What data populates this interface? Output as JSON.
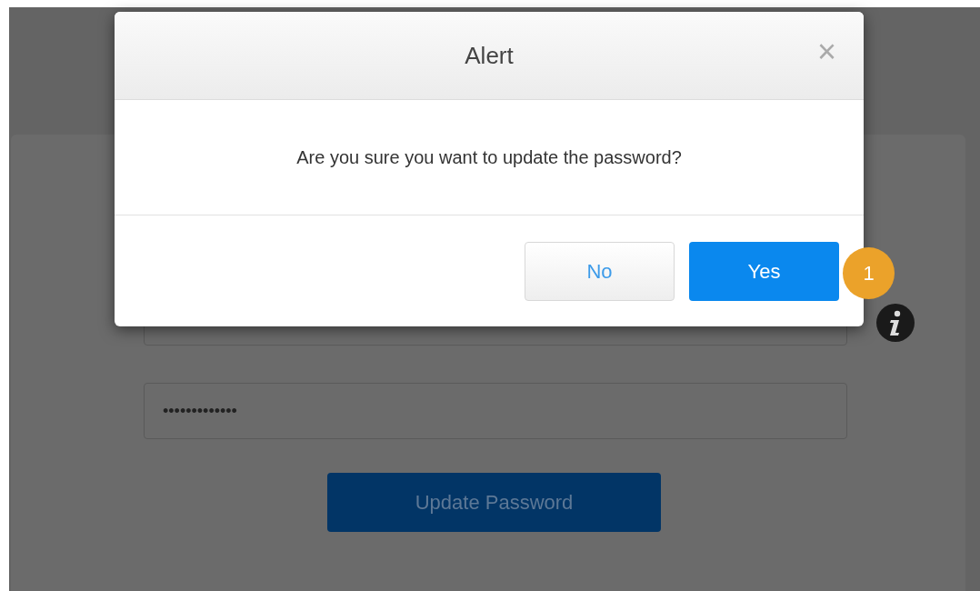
{
  "background": {
    "password_field": {
      "value": "•••••••••••••"
    },
    "update_button": {
      "label": "Update Password",
      "disabled": true
    }
  },
  "dialog": {
    "title": "Alert",
    "close": "×",
    "message": "Are you sure you want to update the password?",
    "buttons": [
      {
        "label": "No",
        "primary": false
      },
      {
        "label": "Yes",
        "primary": true
      }
    ]
  },
  "step_badge": "1"
}
